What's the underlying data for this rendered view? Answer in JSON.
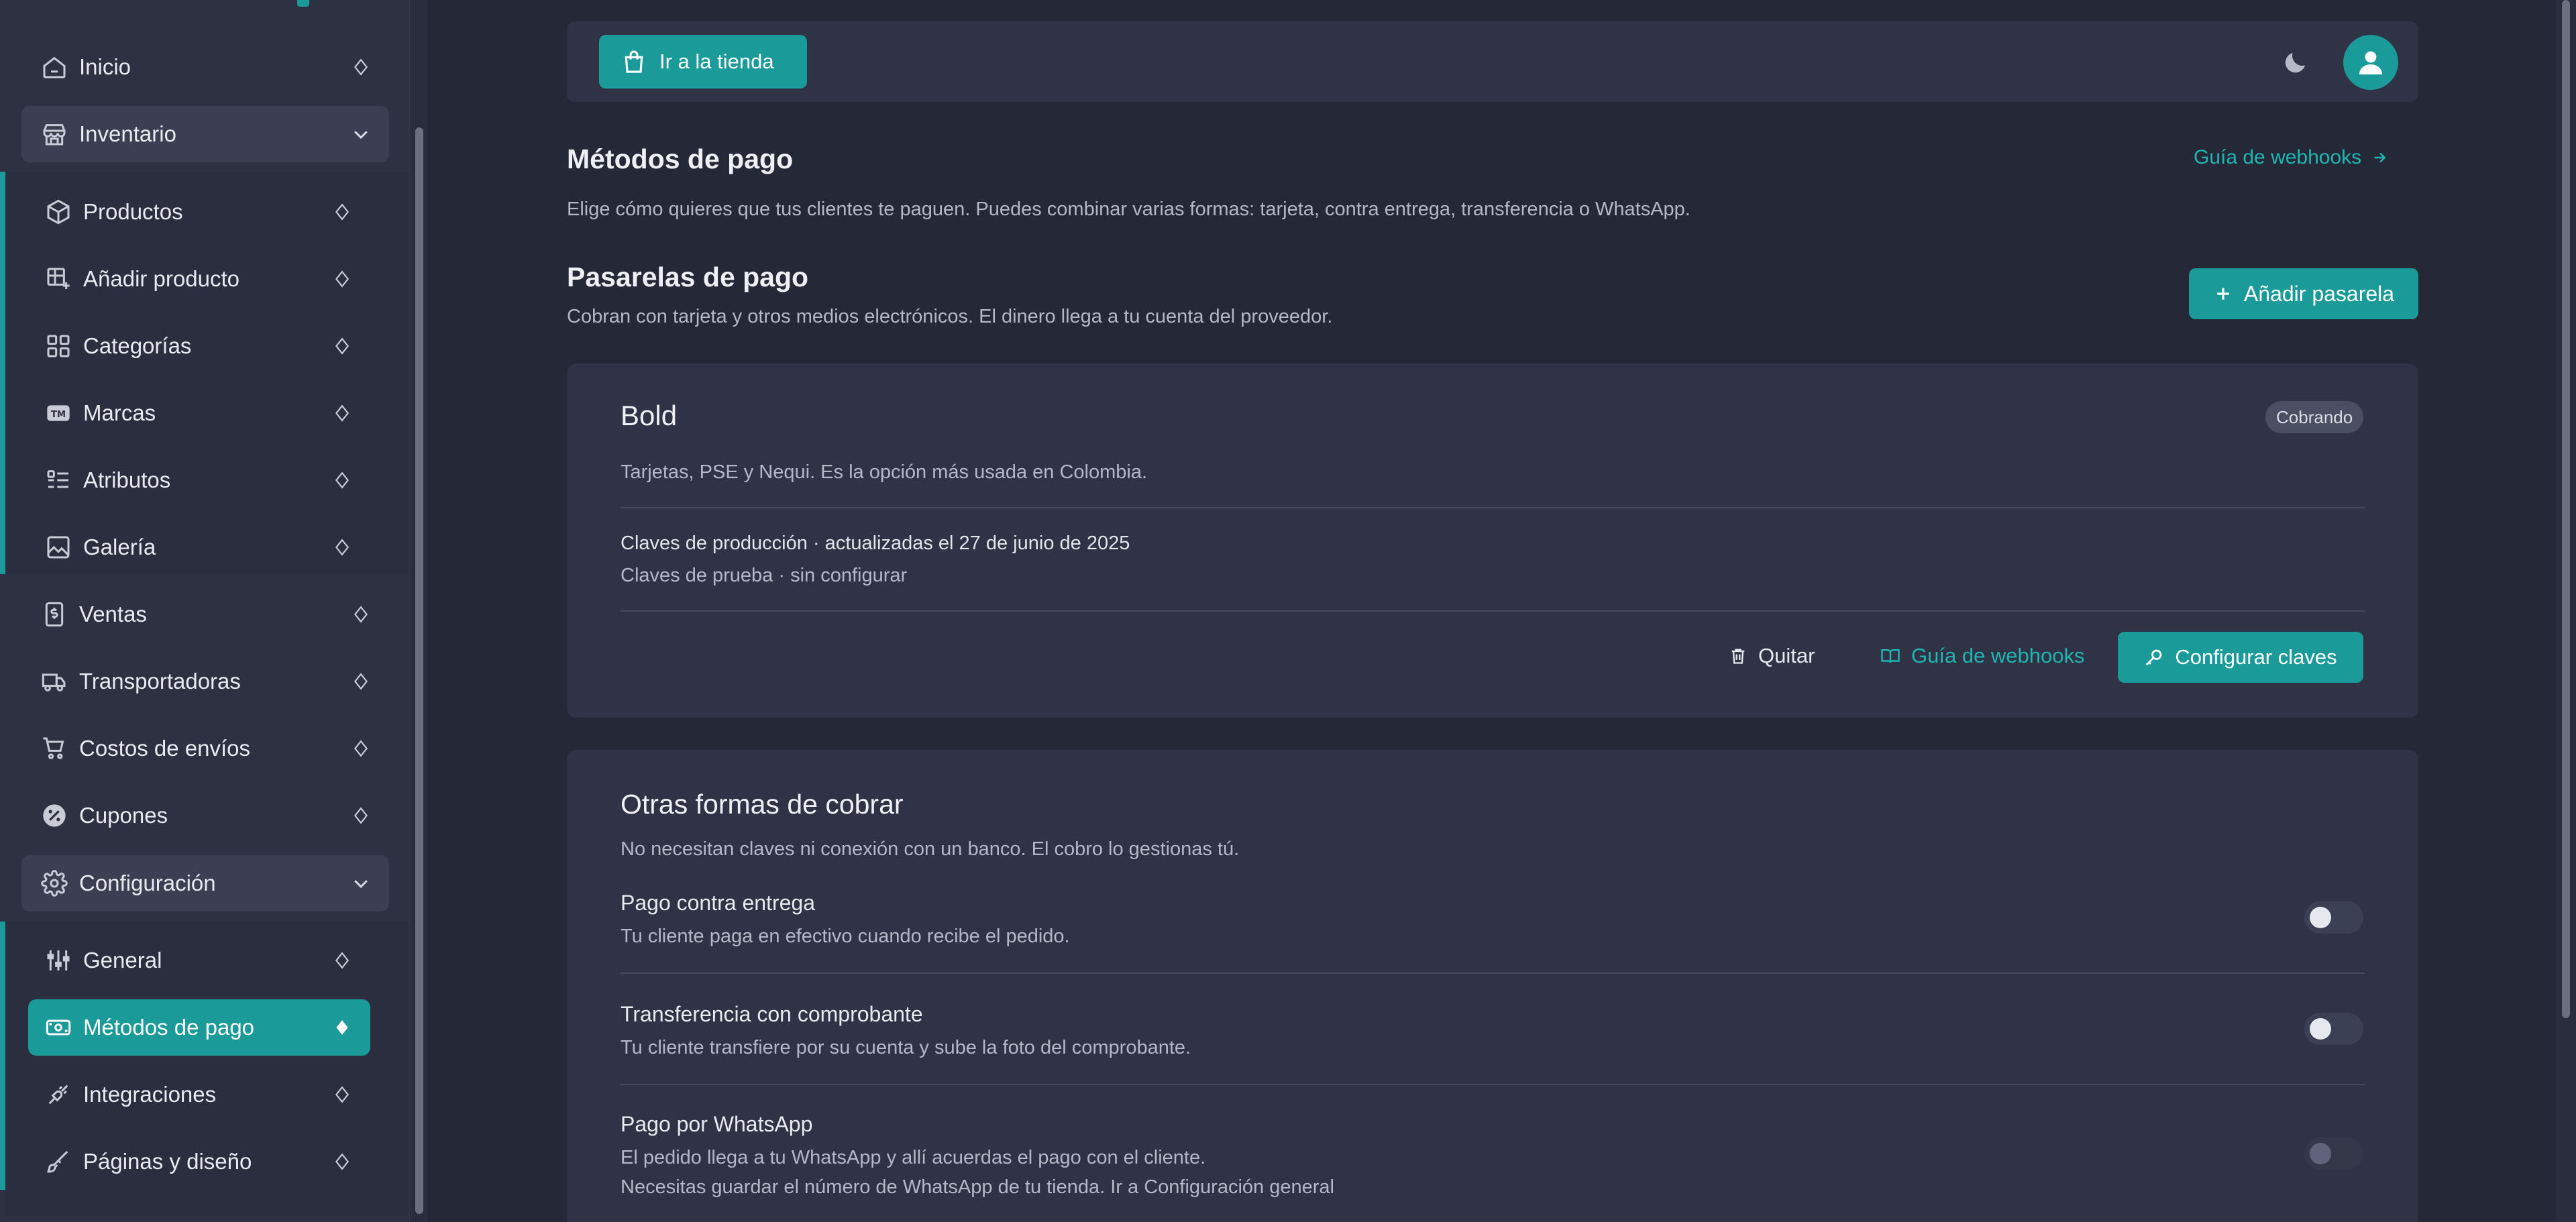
{
  "sidebar": {
    "items": [
      {
        "label": "Inicio",
        "icon": "home-icon"
      },
      {
        "label": "Inventario",
        "icon": "store-icon"
      },
      {
        "label": "Productos",
        "icon": "box-icon"
      },
      {
        "label": "Añadir producto",
        "icon": "add-table-icon"
      },
      {
        "label": "Categorías",
        "icon": "grid-icon"
      },
      {
        "label": "Marcas",
        "icon": "trademark-icon"
      },
      {
        "label": "Atributos",
        "icon": "list-icon"
      },
      {
        "label": "Galería",
        "icon": "image-icon"
      },
      {
        "label": "Ventas",
        "icon": "receipt-icon"
      },
      {
        "label": "Transportadoras",
        "icon": "truck-icon"
      },
      {
        "label": "Costos de envíos",
        "icon": "cart-icon"
      },
      {
        "label": "Cupones",
        "icon": "coupon-icon"
      },
      {
        "label": "Configuración",
        "icon": "gear-icon"
      },
      {
        "label": "General",
        "icon": "sliders-icon"
      },
      {
        "label": "Métodos de pago",
        "icon": "money-icon"
      },
      {
        "label": "Integraciones",
        "icon": "plug-icon"
      },
      {
        "label": "Páginas y diseño",
        "icon": "brush-icon"
      }
    ]
  },
  "topbar": {
    "store_button": "Ir a la tienda"
  },
  "page": {
    "title": "Métodos de pago",
    "description": "Elige cómo quieres que tus clientes te paguen. Puedes combinar varias formas: tarjeta, contra entrega, transferencia o WhatsApp.",
    "webhooks_link": "Guía de webhooks"
  },
  "gateways": {
    "title": "Pasarelas de pago",
    "description": "Cobran con tarjeta y otros medios electrónicos. El dinero llega a tu cuenta del proveedor.",
    "add_button": "Añadir pasarela",
    "bold": {
      "name": "Bold",
      "status": "Cobrando",
      "description": "Tarjetas, PSE y Nequi. Es la opción más usada en Colombia.",
      "prod_keys": "Claves de producción · actualizadas el 27 de junio de 2025",
      "test_keys": "Claves de prueba · sin configurar",
      "remove_button": "Quitar",
      "guide_button": "Guía de webhooks",
      "config_button": "Configurar claves"
    }
  },
  "other": {
    "title": "Otras formas de cobrar",
    "description": "No necesitan claves ni conexión con un banco. El cobro lo gestionas tú.",
    "methods": [
      {
        "title": "Pago contra entrega",
        "desc": "Tu cliente paga en efectivo cuando recibe el pedido.",
        "enabled": false
      },
      {
        "title": "Transferencia con comprobante",
        "desc": "Tu cliente transfiere por su cuenta y sube la foto del comprobante.",
        "enabled": false
      },
      {
        "title": "Pago por WhatsApp",
        "desc": "El pedido llega a tu WhatsApp y allí acuerdas el pago con el cliente.",
        "note": "Necesitas guardar el número de WhatsApp de tu tienda. Ir a Configuración general",
        "enabled": false,
        "disabled": true
      }
    ]
  },
  "colors": {
    "accent": "#1a9a98",
    "background": "#252837",
    "sidebar": "#2d3142",
    "card": "#2f3345"
  }
}
